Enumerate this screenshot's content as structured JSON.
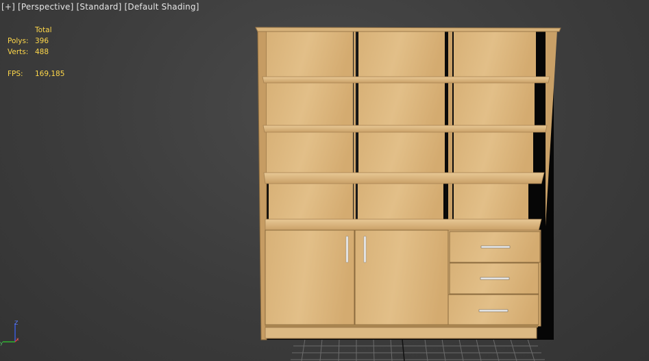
{
  "viewport": {
    "menu": "[+]",
    "view": "[Perspective]",
    "mode": "[Standard]",
    "shading": "[Default Shading]"
  },
  "stats": {
    "header": "Total",
    "polys_label": "Polys:",
    "polys": "396",
    "verts_label": "Verts:",
    "verts": "488",
    "fps_label": "FPS:",
    "fps": "169,185"
  },
  "axis": {
    "z_label": "Z",
    "y_label": "y",
    "x_label": "x"
  },
  "colors": {
    "background": "#3c3c3c",
    "stats_text": "#ffd84a",
    "wood": "#d9b177",
    "wood_light": "#e4c38e",
    "wood_dark": "#b8935c",
    "shadow": "#050505",
    "grid": "#6a6a6a"
  },
  "model": {
    "name": "bookcase",
    "shelf_columns": 3,
    "shelf_rows": 4,
    "doors": 2,
    "drawers": 3
  }
}
